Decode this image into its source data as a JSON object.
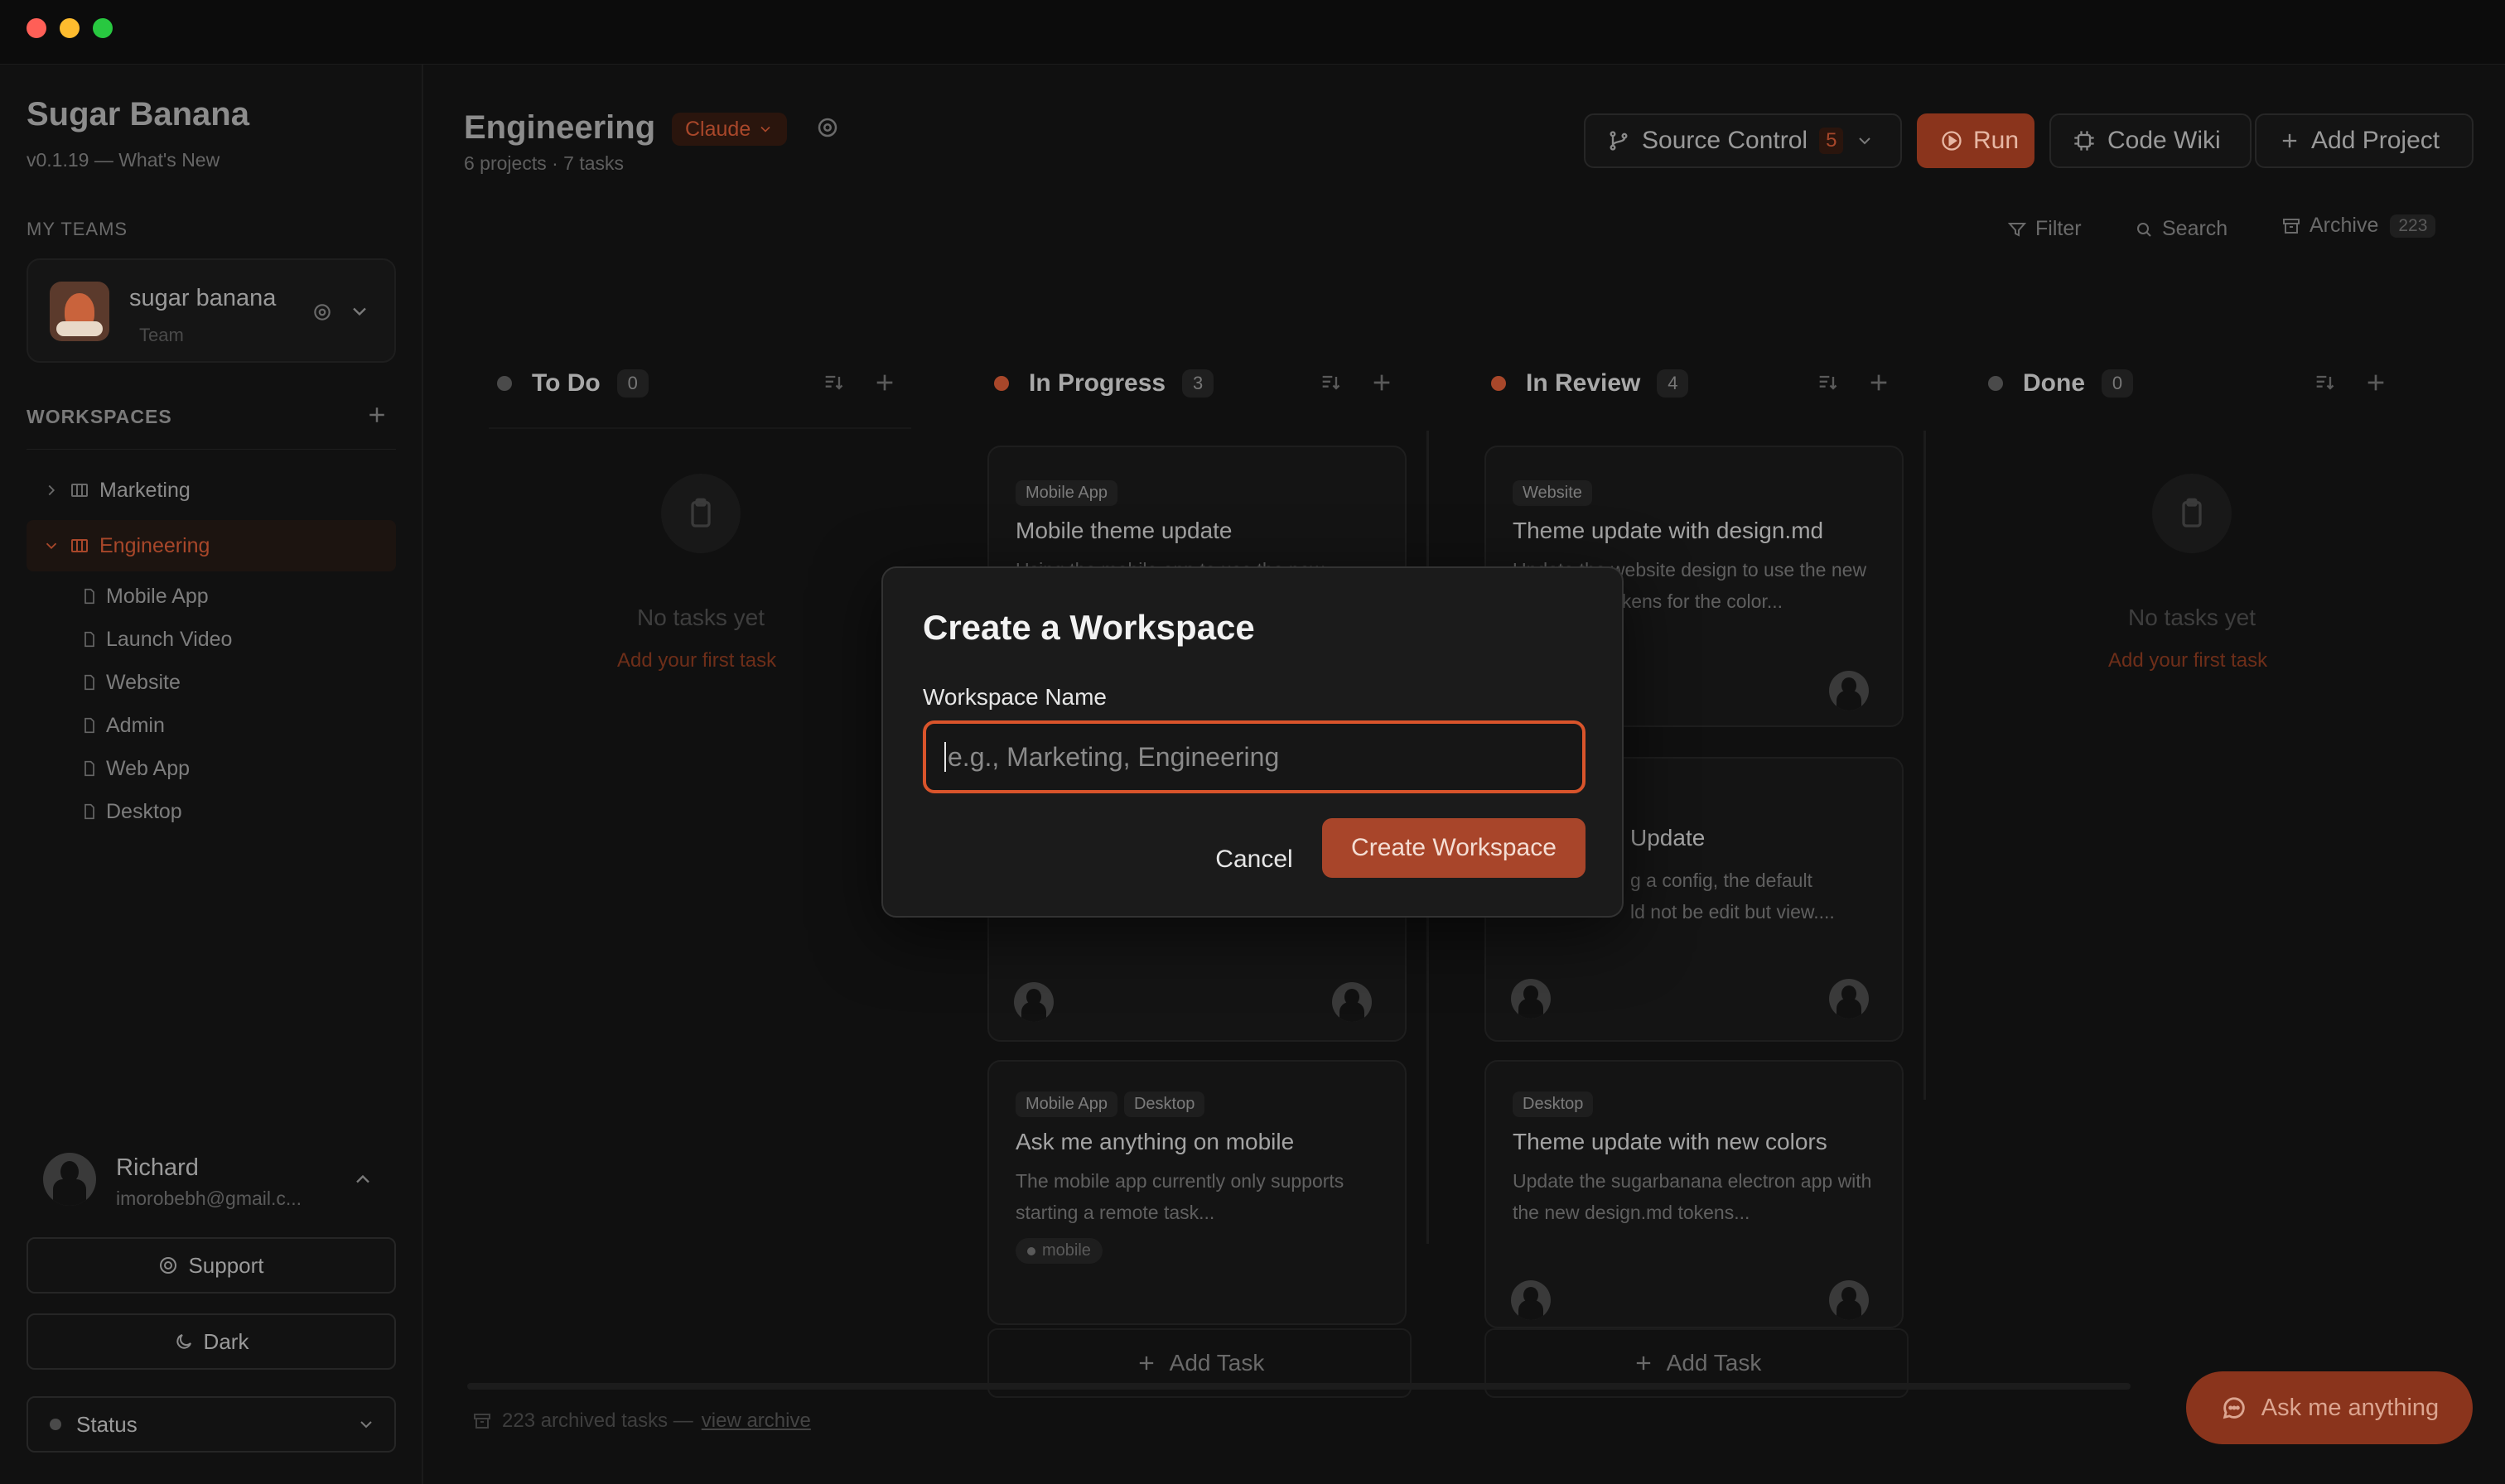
{
  "colors": {
    "accent": "#d9542b",
    "accent_dim": "#b04826",
    "bg": "#101010",
    "sidebar": "#111111",
    "modal": "#1b1b1b"
  },
  "app": {
    "name": "Sugar Banana",
    "version": "v0.1.19 — What's New"
  },
  "sidebar": {
    "my_teams_label": "MY TEAMS",
    "team": {
      "name": "sugar banana",
      "role": "Team"
    },
    "workspaces_label": "WORKSPACES",
    "workspaces": [
      {
        "label": "Marketing",
        "expanded": false
      },
      {
        "label": "Engineering",
        "expanded": true
      }
    ],
    "projects": [
      "Mobile App",
      "Launch Video",
      "Website",
      "Admin",
      "Web App",
      "Desktop"
    ],
    "user": {
      "name": "Richard",
      "email": "imorobebh@gmail.c..."
    },
    "support_label": "Support",
    "theme_label": "Dark",
    "status_label": "Status"
  },
  "header": {
    "title": "Engineering",
    "model": "Claude",
    "subtitle": "6 projects · 7 tasks",
    "source_control_label": "Source Control",
    "source_control_count": "5",
    "run_label": "Run",
    "code_wiki_label": "Code Wiki",
    "add_project_label": "Add Project",
    "filter_label": "Filter",
    "search_label": "Search",
    "archive_label": "Archive",
    "archive_count": "223"
  },
  "columns": [
    {
      "name": "To Do",
      "count": "0",
      "dot": "#4a4a4a"
    },
    {
      "name": "In Progress",
      "count": "3",
      "dot": "#d9542b"
    },
    {
      "name": "In Review",
      "count": "4",
      "dot": "#d9542b"
    },
    {
      "name": "Done",
      "count": "0",
      "dot": "#4a4a4a"
    }
  ],
  "empty_state": {
    "text": "No tasks yet",
    "link": "Add your first task"
  },
  "cards": {
    "progress_1": {
      "tags": [
        "Mobile App"
      ],
      "title": "Mobile theme update",
      "desc": "Using the mobile app to use the new theme colors specified in the..."
    },
    "progress_3": {
      "tags": [
        "Mobile App",
        "Desktop"
      ],
      "title": "Ask me anything on mobile",
      "desc": "The mobile app currently only supports starting a remote task...",
      "label": "mobile"
    },
    "review_1": {
      "tags": [
        "Website"
      ],
      "title": "Theme update with design.md",
      "desc": "Update the website design to use the new design.md tokens for the color..."
    },
    "review_2": {
      "title_fragment": "Update",
      "desc_fragment_1": "g a config, the default",
      "desc_fragment_2": "ld not be edit but view...."
    },
    "review_3": {
      "tags": [
        "Desktop"
      ],
      "title": "Theme update with new colors",
      "desc": "Update the sugarbanana electron app with the new design.md tokens..."
    }
  },
  "add_task_label": "Add Task",
  "footer": {
    "archived_text": "223 archived tasks —",
    "view_archive": "view archive"
  },
  "ask_button": "Ask me anything",
  "modal": {
    "title": "Create a Workspace",
    "field_label": "Workspace Name",
    "placeholder": "e.g., Marketing, Engineering",
    "cancel": "Cancel",
    "create": "Create Workspace"
  }
}
